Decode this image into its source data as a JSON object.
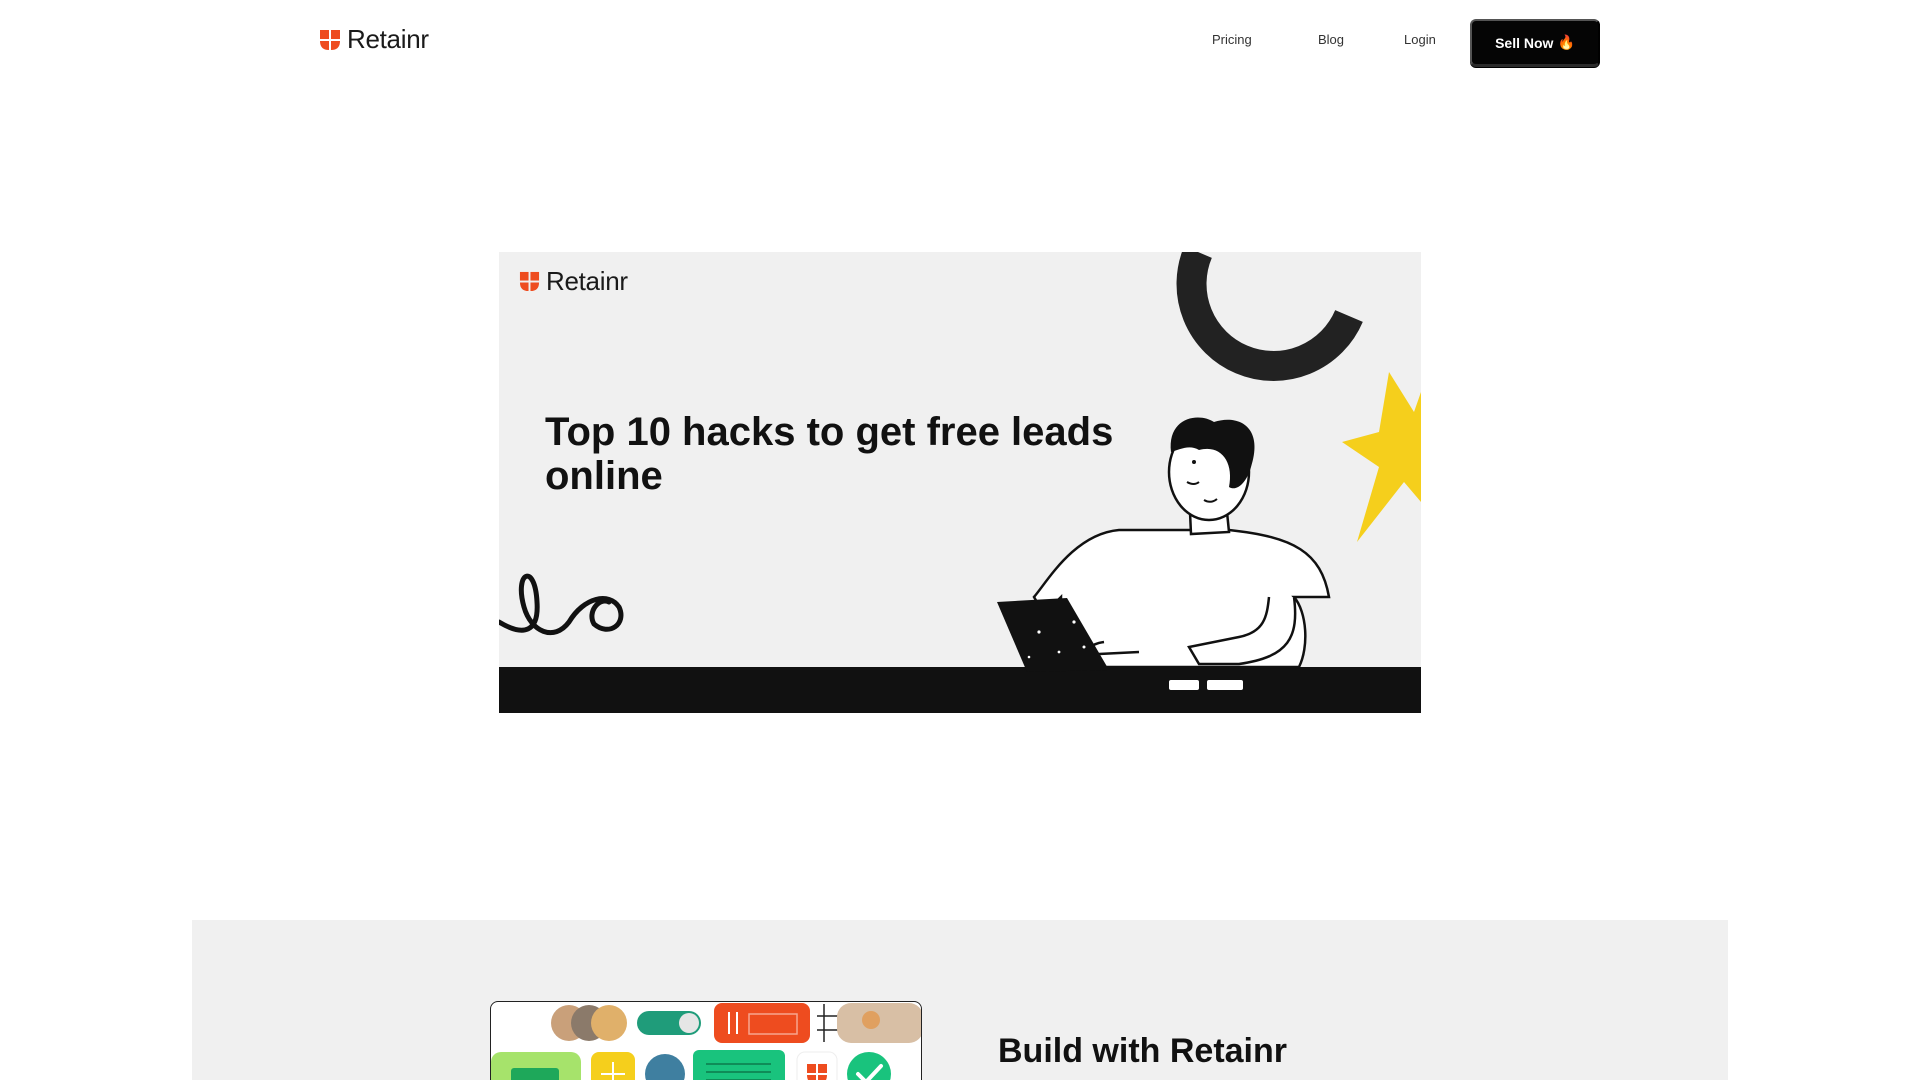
{
  "header": {
    "brand": "Retainr",
    "nav": [
      {
        "label": "Pricing"
      },
      {
        "label": "Blog"
      },
      {
        "label": "Login"
      }
    ],
    "cta": {
      "label": "Sell Now",
      "icon": "fire-icon",
      "emoji": "🔥"
    }
  },
  "hero": {
    "brand": "Retainr",
    "title": "Top 10 hacks to get free leads online"
  },
  "build": {
    "title": "Build with Retainr"
  },
  "colors": {
    "brand_orange": "#ee4c1f",
    "accent_yellow": "#f5cf1c",
    "hero_bg": "#f0f0f0",
    "button_bg": "#050505"
  }
}
